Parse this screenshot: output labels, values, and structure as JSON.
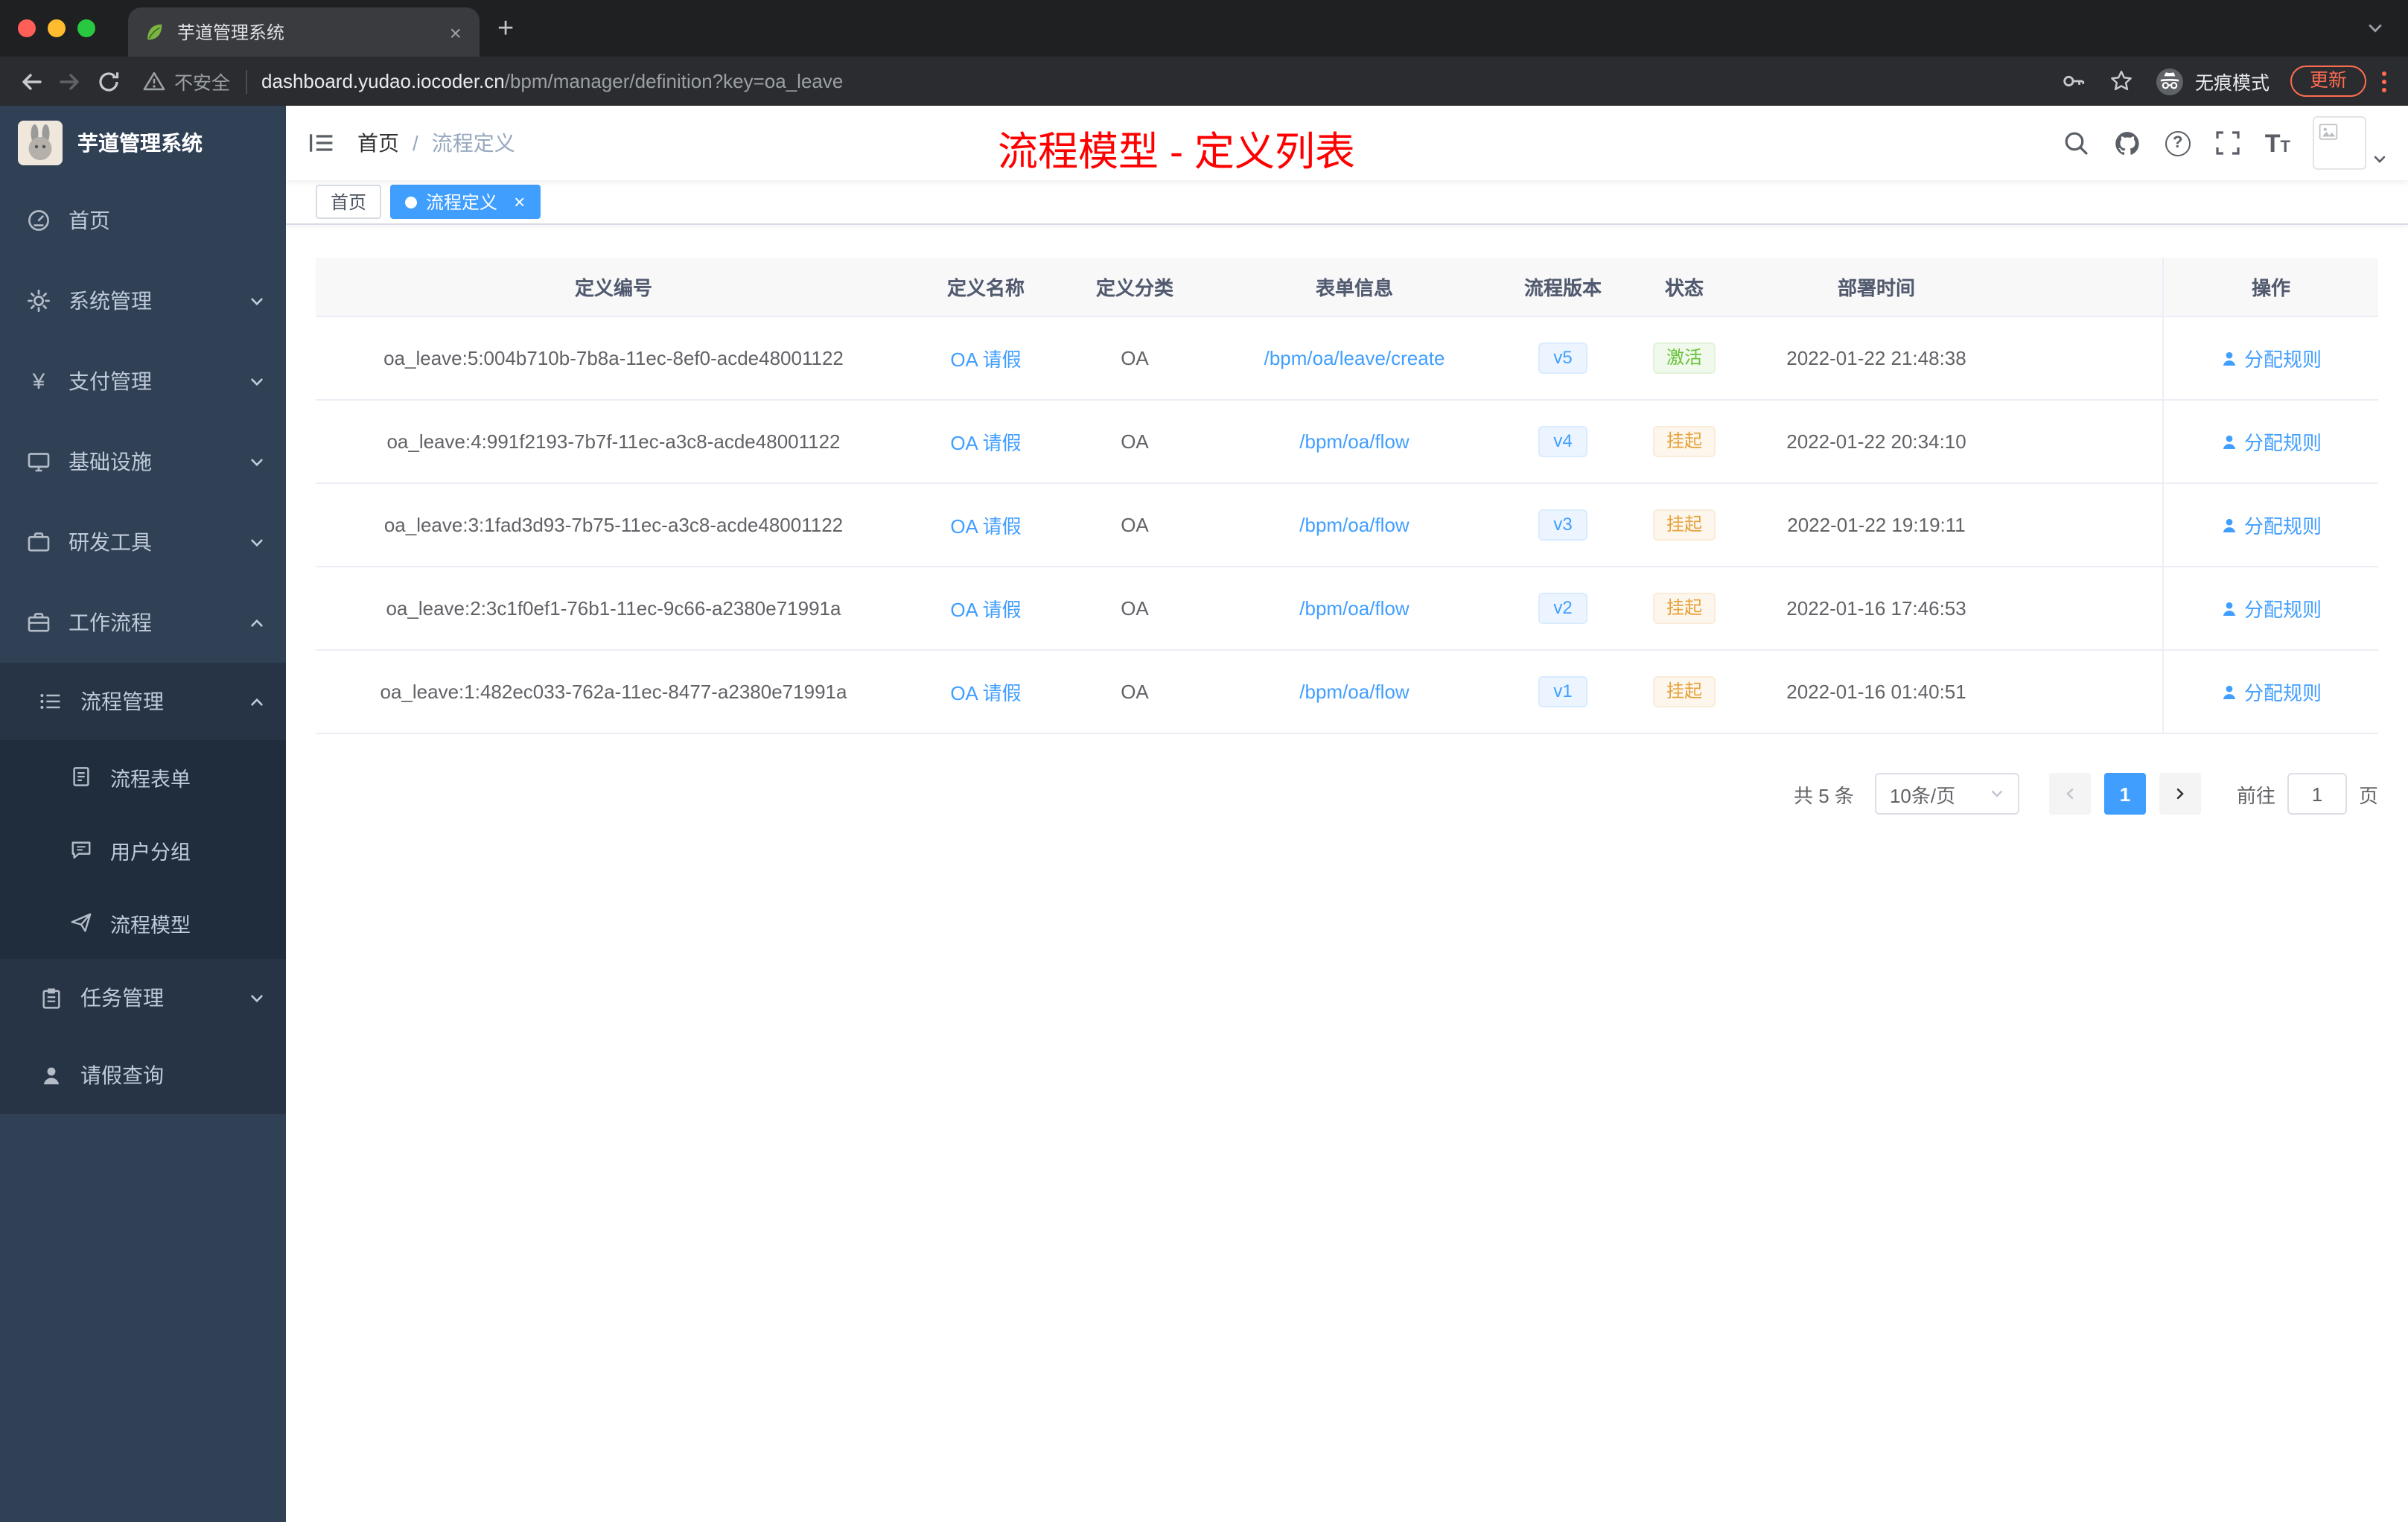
{
  "browser": {
    "tab_title": "芋道管理系统",
    "security_label": "不安全",
    "url_host": "dashboard.yudao.iocoder.cn",
    "url_path": "/bpm/manager/definition?key=oa_leave",
    "incognito_label": "无痕模式",
    "update_label": "更新"
  },
  "sidebar": {
    "logo_title": "芋道管理系统",
    "items": [
      {
        "label": "首页"
      },
      {
        "label": "系统管理"
      },
      {
        "label": "支付管理"
      },
      {
        "label": "基础设施"
      },
      {
        "label": "研发工具"
      },
      {
        "label": "工作流程"
      },
      {
        "label": "流程管理"
      },
      {
        "label": "流程表单"
      },
      {
        "label": "用户分组"
      },
      {
        "label": "流程模型"
      },
      {
        "label": "任务管理"
      },
      {
        "label": "请假查询"
      }
    ]
  },
  "header": {
    "breadcrumb_home": "首页",
    "breadcrumb_separator": "/",
    "breadcrumb_current": "流程定义",
    "page_title": "流程模型 - 定义列表"
  },
  "tags": {
    "home": "首页",
    "active": "流程定义"
  },
  "table": {
    "columns": {
      "id": "定义编号",
      "name": "定义名称",
      "category": "定义分类",
      "form": "表单信息",
      "version": "流程版本",
      "status": "状态",
      "deploy_time": "部署时间",
      "action": "操作"
    },
    "rows": [
      {
        "id": "oa_leave:5:004b710b-7b8a-11ec-8ef0-acde48001122",
        "name": "OA 请假",
        "category": "OA",
        "form": "/bpm/oa/leave/create",
        "version": "v5",
        "status": "激活",
        "deploy_time": "2022-01-22 21:48:38",
        "action": "分配规则"
      },
      {
        "id": "oa_leave:4:991f2193-7b7f-11ec-a3c8-acde48001122",
        "name": "OA 请假",
        "category": "OA",
        "form": "/bpm/oa/flow",
        "version": "v4",
        "status": "挂起",
        "deploy_time": "2022-01-22 20:34:10",
        "action": "分配规则"
      },
      {
        "id": "oa_leave:3:1fad3d93-7b75-11ec-a3c8-acde48001122",
        "name": "OA 请假",
        "category": "OA",
        "form": "/bpm/oa/flow",
        "version": "v3",
        "status": "挂起",
        "deploy_time": "2022-01-22 19:19:11",
        "action": "分配规则"
      },
      {
        "id": "oa_leave:2:3c1f0ef1-76b1-11ec-9c66-a2380e71991a",
        "name": "OA 请假",
        "category": "OA",
        "form": "/bpm/oa/flow",
        "version": "v2",
        "status": "挂起",
        "deploy_time": "2022-01-16 17:46:53",
        "action": "分配规则"
      },
      {
        "id": "oa_leave:1:482ec033-762a-11ec-8477-a2380e71991a",
        "name": "OA 请假",
        "category": "OA",
        "form": "/bpm/oa/flow",
        "version": "v1",
        "status": "挂起",
        "deploy_time": "2022-01-16 01:40:51",
        "action": "分配规则"
      }
    ]
  },
  "pagination": {
    "total": "共 5 条",
    "page_size": "10条/页",
    "current_page": "1",
    "goto_label": "前往",
    "goto_value": "1",
    "goto_unit": "页"
  },
  "colors": {
    "accent": "#409eff",
    "success": "#67c23a",
    "warning": "#e6a23c",
    "title_red": "#ff0000",
    "sidebar_bg": "#304156"
  }
}
